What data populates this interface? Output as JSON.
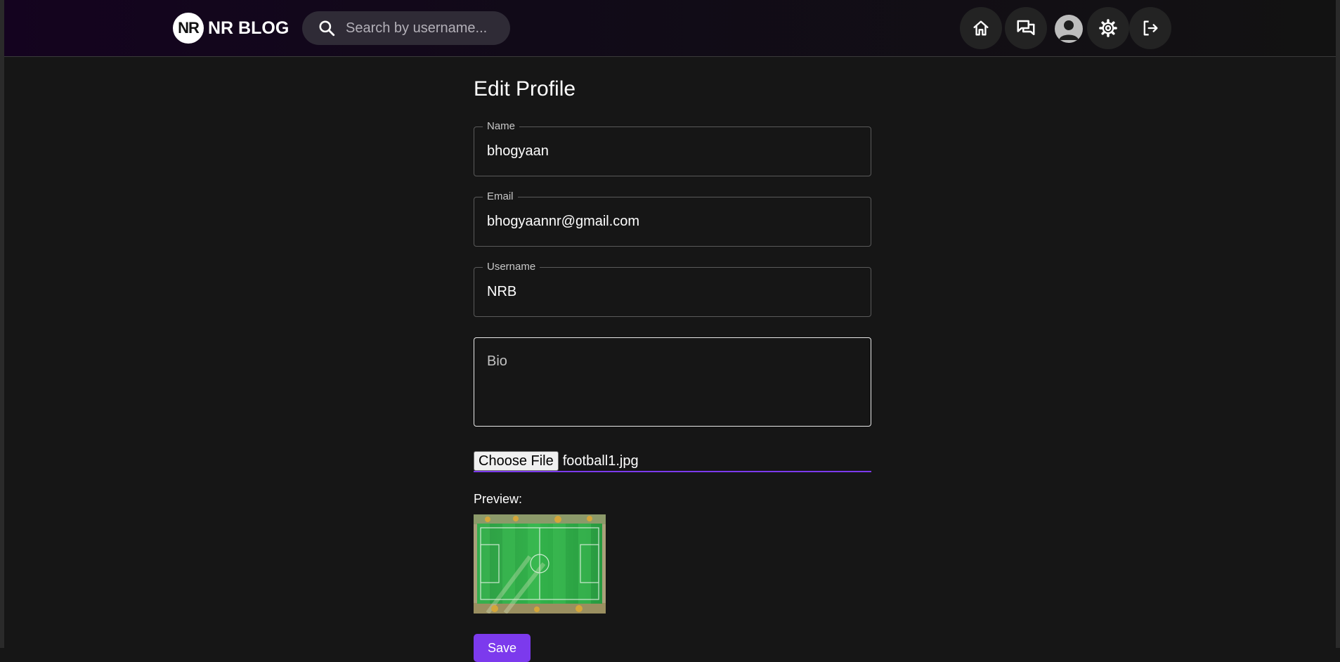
{
  "header": {
    "logo_initials": "NR",
    "logo_text": "NR BLOG",
    "search_placeholder": "Search by username..."
  },
  "page": {
    "title": "Edit Profile"
  },
  "form": {
    "name_label": "Name",
    "name_value": "bhogyaan",
    "email_label": "Email",
    "email_value": "bhogyaannr@gmail.com",
    "username_label": "Username",
    "username_value": "NRB",
    "bio_placeholder": "Bio",
    "choose_file_label": "Choose File",
    "file_name": "football1.jpg",
    "preview_label": "Preview:",
    "save_label": "Save"
  },
  "colors": {
    "accent": "#7c3aed",
    "background": "#161616"
  }
}
